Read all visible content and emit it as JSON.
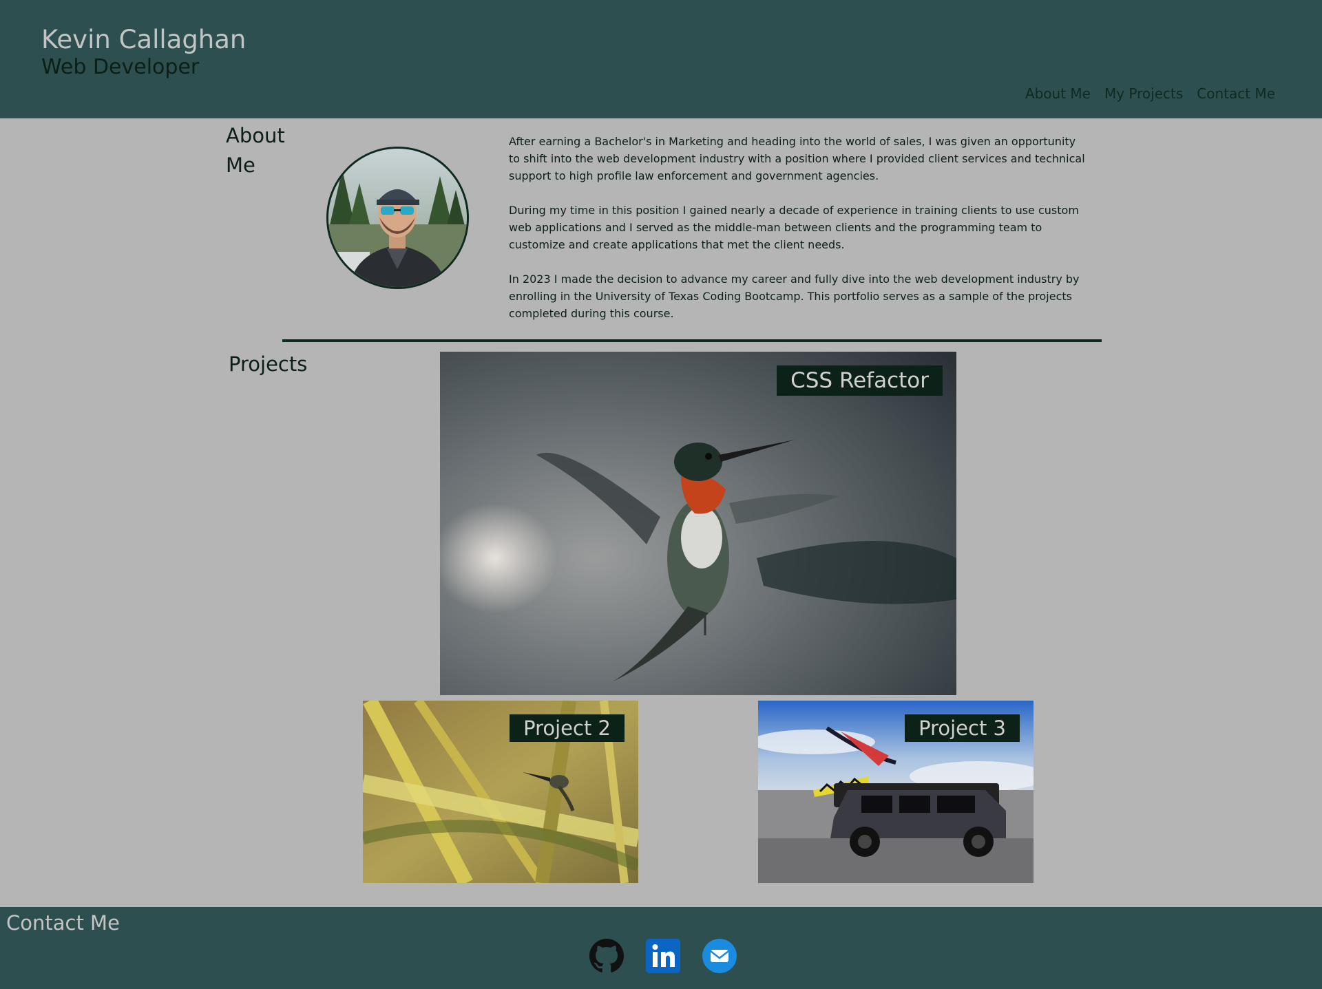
{
  "header": {
    "name": "Kevin Callaghan",
    "title": "Web Developer",
    "nav": [
      {
        "label": "About Me"
      },
      {
        "label": "My Projects"
      },
      {
        "label": "Contact Me"
      }
    ]
  },
  "about": {
    "heading": "About Me",
    "paragraphs": [
      "After earning a Bachelor's in Marketing and heading into the world of sales, I was given an opportunity to shift into the web development industry with a position where I provided client services and technical support to high profile law enforcement and government agencies.",
      "During my time in this position I gained nearly a decade of experience in training clients to use custom web applications and I served as the middle-man between clients and the programming team to customize and create applications that met the client needs.",
      "In 2023 I made the decision to advance my career and fully dive into the web development industry by enrolling in the University of Texas Coding Bootcamp. This portfolio serves as a sample of the projects completed during this course."
    ]
  },
  "projects": {
    "heading": "Projects",
    "items": [
      {
        "label": "CSS Refactor"
      },
      {
        "label": "Project 2"
      },
      {
        "label": "Project 3"
      }
    ]
  },
  "footer": {
    "heading": "Contact Me",
    "links": [
      {
        "icon": "github-icon"
      },
      {
        "icon": "linkedin-icon"
      },
      {
        "icon": "email-icon"
      }
    ]
  },
  "colors": {
    "header_bg": "#2d4f4f",
    "page_bg": "#b5b5b5",
    "label_bg": "#0c2218",
    "linkedin_blue": "#0a66c2",
    "email_blue": "#1b8be0"
  }
}
